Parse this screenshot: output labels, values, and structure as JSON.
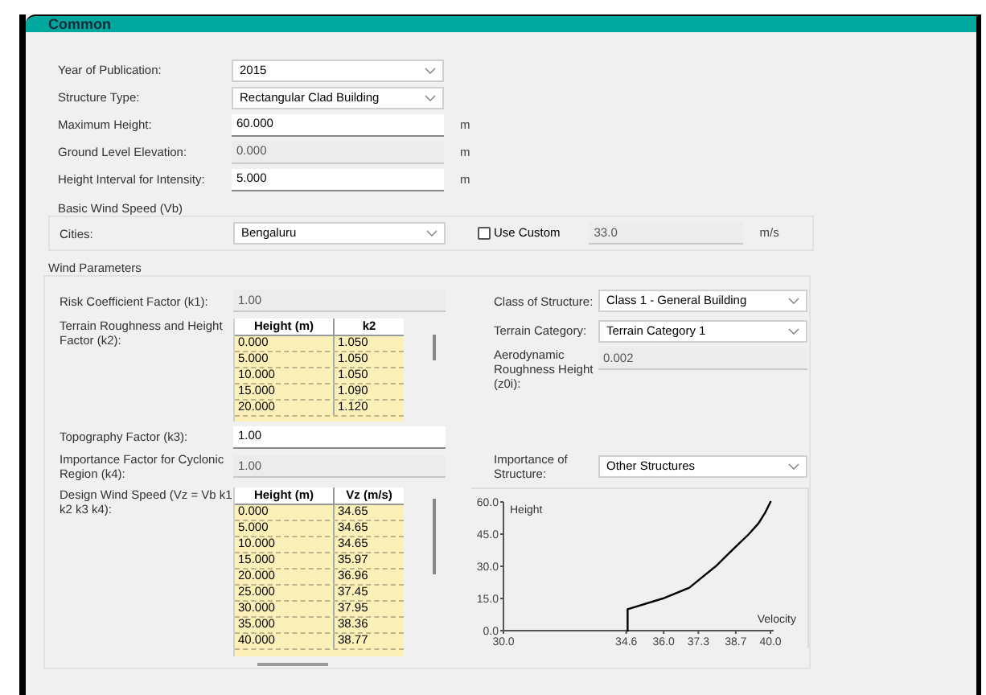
{
  "header": {
    "title": "Common"
  },
  "general_fields": [
    {
      "label": "Year of Publication:",
      "kind": "dropdown",
      "value": "2015"
    },
    {
      "label": "Structure Type:",
      "kind": "dropdown",
      "value": "Rectangular Clad Building"
    },
    {
      "label": "Maximum Height:",
      "kind": "input",
      "value": "60.000",
      "unit": "m"
    },
    {
      "label": "Ground Level Elevation:",
      "kind": "readonly",
      "value": "0.000",
      "unit": "m"
    },
    {
      "label": "Height Interval for Intensity:",
      "kind": "input",
      "value": "5.000",
      "unit": "m"
    }
  ],
  "basic_wind_speed": {
    "title": "Basic Wind Speed (Vb)",
    "cities": {
      "label": "Cities:",
      "kind": "dropdown",
      "value": "Bengaluru"
    },
    "use_custom": {
      "label": "Use Custom",
      "checked": false
    },
    "custom_speed": {
      "kind": "readonly",
      "value": "33.0",
      "unit": "m/s"
    }
  },
  "wind_parameters": {
    "title": "Wind Parameters",
    "k1": {
      "label": "Risk Coefficient Factor (k1):",
      "kind": "readonly",
      "value": "1.00"
    },
    "class_of_structure": {
      "label": "Class of Structure:",
      "kind": "dropdown",
      "value": "Class 1 - General Building"
    },
    "k2": {
      "label": "Terrain Roughness and Height Factor (k2):",
      "table": {
        "columns": [
          "Height (m)",
          "k2"
        ],
        "rows": [
          [
            "0.000",
            "1.050"
          ],
          [
            "5.000",
            "1.050"
          ],
          [
            "10.000",
            "1.050"
          ],
          [
            "15.000",
            "1.090"
          ],
          [
            "20.000",
            "1.120"
          ]
        ]
      }
    },
    "terrain_category": {
      "label": "Terrain Category:",
      "kind": "dropdown",
      "value": "Terrain Category 1"
    },
    "roughness_height": {
      "label": "Aerodynamic Roughness Height (z0i):",
      "kind": "readonly",
      "value": "0.002"
    },
    "k3": {
      "label": "Topography Factor (k3):",
      "kind": "input",
      "value": "1.00"
    },
    "k4": {
      "label": "Importance Factor for Cyclonic Region (k4):",
      "kind": "readonly",
      "value": "1.00"
    },
    "importance": {
      "label": "Importance of Structure:",
      "kind": "dropdown",
      "value": "Other Structures"
    },
    "vz": {
      "label": "Design Wind Speed (Vz = Vb k1 k2 k3 k4):",
      "table": {
        "columns": [
          "Height (m)",
          "Vz (m/s)"
        ],
        "rows": [
          [
            "0.000",
            "34.65"
          ],
          [
            "5.000",
            "34.65"
          ],
          [
            "10.000",
            "34.65"
          ],
          [
            "15.000",
            "35.97"
          ],
          [
            "20.000",
            "36.96"
          ],
          [
            "25.000",
            "37.45"
          ],
          [
            "30.000",
            "37.95"
          ],
          [
            "35.000",
            "38.36"
          ],
          [
            "40.000",
            "38.77"
          ]
        ]
      }
    },
    "chart_data": {
      "type": "line",
      "xlabel": "Velocity",
      "ylabel": "Height",
      "xlim": [
        30,
        40
      ],
      "ylim": [
        0,
        60
      ],
      "x": [
        34.65,
        34.65,
        34.65,
        35.97,
        36.96,
        37.45,
        37.95,
        38.36,
        38.77,
        39.19,
        39.55,
        39.8,
        40.0
      ],
      "series": [
        {
          "color": "#000000",
          "values": [
            0,
            5,
            10,
            15,
            20,
            25,
            30,
            35,
            40,
            45,
            50,
            55,
            60
          ]
        }
      ],
      "xticks": [
        {
          "value": 30,
          "label": "30.0"
        },
        {
          "value": 34.6,
          "label": "34.6"
        },
        {
          "value": 36.0,
          "label": "36.0"
        },
        {
          "value": 37.3,
          "label": "37.3"
        },
        {
          "value": 38.7,
          "label": "38.7"
        },
        {
          "value": 40,
          "label": "40.0"
        }
      ],
      "yticks": [
        {
          "value": 0,
          "label": "0.0"
        },
        {
          "value": 15,
          "label": "15.0"
        },
        {
          "value": 30,
          "label": "30.0"
        },
        {
          "value": 45,
          "label": "45.0"
        },
        {
          "value": 60,
          "label": "60.0"
        }
      ]
    }
  }
}
